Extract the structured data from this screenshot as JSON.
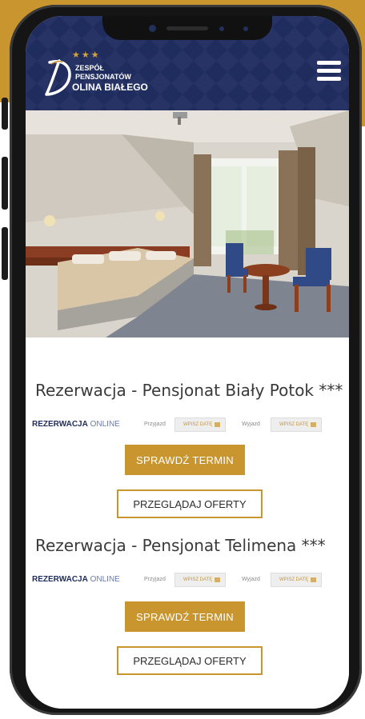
{
  "colors": {
    "gold": "#c9952e",
    "navy": "#1f2c5e"
  },
  "header": {
    "logo": {
      "stars": "★★★",
      "line1": "ZESPÓŁ",
      "line2": "PENSJONATÓW",
      "line3": "OLINA BIAŁEGO",
      "mark_icon": "d-letter-logo-icon"
    },
    "menu_icon": "hamburger-menu-icon"
  },
  "hero": {
    "subject": "hotel-room-photo"
  },
  "reservations": [
    {
      "title": "Rezerwacja - Pensjonat Biały Potok ***",
      "brand_bold": "REZERWACJA",
      "brand_light": " ONLINE",
      "arrival_label": "Przyjazd",
      "arrival_value": "WPISZ DATĘ",
      "departure_label": "Wyjazd",
      "departure_value": "WPISZ DATĘ",
      "check_button": "SPRAWDŹ TERMIN",
      "offers_button": "PRZEGLĄDAJ OFERTY"
    },
    {
      "title": "Rezerwacja - Pensjonat Telimena ***",
      "brand_bold": "REZERWACJA",
      "brand_light": " ONLINE",
      "arrival_label": "Przyjazd",
      "arrival_value": "WPISZ DATĘ",
      "departure_label": "Wyjazd",
      "departure_value": "WPISZ DATĘ",
      "check_button": "SPRAWDŹ TERMIN",
      "offers_button": "PRZEGLĄDAJ OFERTY"
    }
  ]
}
